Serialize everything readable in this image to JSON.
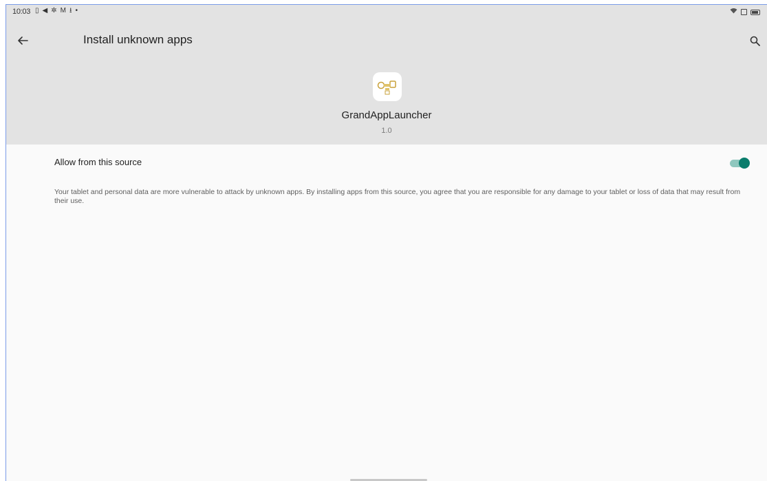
{
  "status_bar": {
    "time": "10:03",
    "left_icons": [
      "vibrate-icon",
      "telegram-icon",
      "settings-icon",
      "gmail-icon",
      "download-icon",
      "dot-icon"
    ],
    "right_icons": [
      "wifi-icon",
      "sim-icon",
      "battery-icon"
    ]
  },
  "toolbar": {
    "title": "Install unknown apps"
  },
  "app": {
    "name": "GrandAppLauncher",
    "version": "1.0",
    "icon": "grand-app-launcher-icon"
  },
  "allow_setting": {
    "label": "Allow from this source",
    "enabled": true,
    "accent_color": "#0a7d6c"
  },
  "description": "Your tablet and personal data are more vulnerable to attack by unknown apps. By installing apps from this source, you agree that you are responsible for any damage to your tablet or loss of data that may result from their use."
}
